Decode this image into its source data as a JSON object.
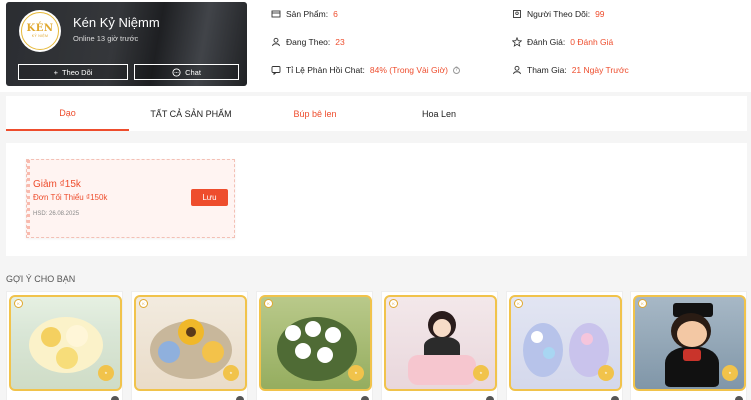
{
  "shop": {
    "name": "Kén Kỷ Niệmm",
    "logo_text": "KÉN",
    "logo_sub": "KỶ NIỆM",
    "status": "Online 13 giờ trước",
    "follow_label": "Theo Dõi",
    "chat_label": "Chat"
  },
  "stats": {
    "products_label": "Sản Phẩm:",
    "products_value": "6",
    "following_label": "Đang Theo:",
    "following_value": "23",
    "chat_rate_label": "Tỉ Lệ Phản Hồi Chat:",
    "chat_rate_value": "84% (Trong Vài Giờ)",
    "followers_label": "Người Theo Dõi:",
    "followers_value": "99",
    "rating_label": "Đánh Giá:",
    "rating_value": "0 Đánh Giá",
    "joined_label": "Tham Gia:",
    "joined_value": "21 Ngày Trước"
  },
  "tabs": [
    {
      "label": "Dạo",
      "active": true
    },
    {
      "label": "TẤT CẢ SẢN PHẨM",
      "active": false
    },
    {
      "label": "Búp bê len",
      "active": false
    },
    {
      "label": "Hoa Len",
      "active": false
    }
  ],
  "voucher": {
    "title": "Giảm ₫15k",
    "min_order": "Đơn Tối Thiểu ₫150k",
    "expiry": "HSD: 26.08.2025",
    "save_label": "Lưu"
  },
  "recommend_title": "GỢI Ý CHO BẠN",
  "colors": {
    "accent": "#ee4d2d",
    "brand_gold": "#e0a82e"
  }
}
